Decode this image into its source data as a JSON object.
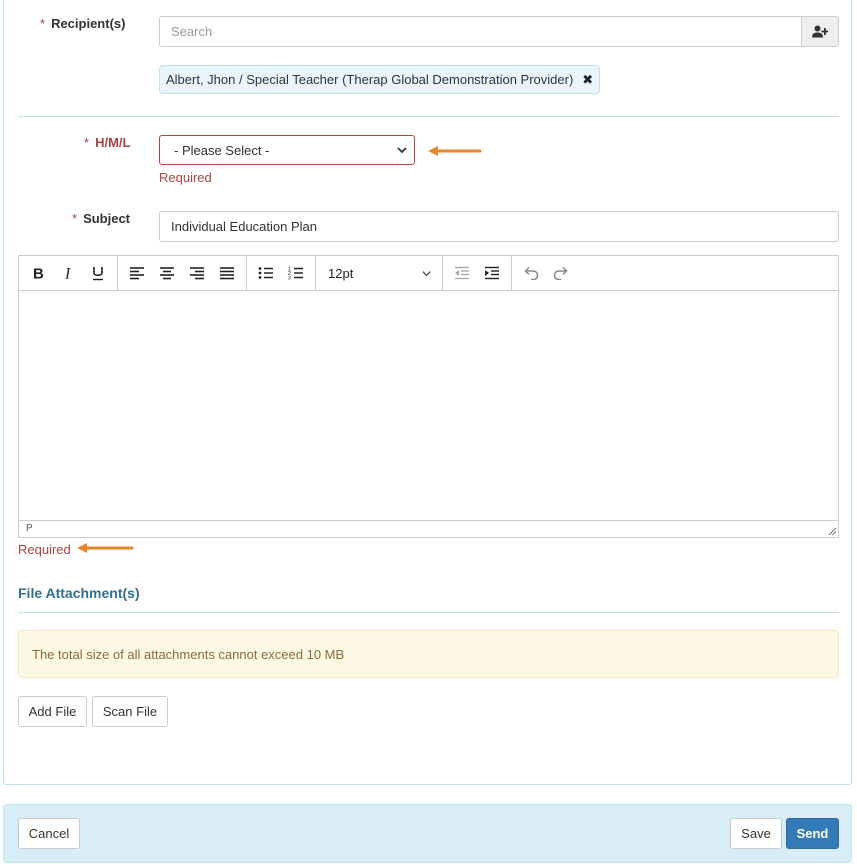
{
  "form": {
    "recipients": {
      "label": "Recipient(s)",
      "required_mark": "*",
      "placeholder": "Search",
      "add_icon": "user-plus-icon",
      "chips": [
        {
          "text": "Albert, Jhon / Special Teacher (Therap Global Demonstration Provider)",
          "remove_glyph": "✖"
        }
      ]
    },
    "hml": {
      "label": "H/M/L",
      "required_mark": "*",
      "selected": "- Please Select -",
      "error": "Required"
    },
    "subject": {
      "label": "Subject",
      "required_mark": "*",
      "value": "Individual Education Plan"
    },
    "editor": {
      "font_size": "12pt",
      "status_path": "P",
      "error": "Required",
      "toolbar_icons": [
        "bold-icon",
        "italic-icon",
        "underline-icon",
        "align-left-icon",
        "align-center-icon",
        "align-right-icon",
        "align-justify-icon",
        "bullet-list-icon",
        "numbered-list-icon",
        "outdent-icon",
        "indent-icon",
        "undo-icon",
        "redo-icon"
      ]
    },
    "attachments": {
      "title": "File Attachment(s)",
      "notice": "The total size of all attachments cannot exceed 10 MB",
      "add_file_label": "Add File",
      "scan_file_label": "Scan File"
    }
  },
  "footer": {
    "cancel_label": "Cancel",
    "save_label": "Save",
    "send_label": "Send"
  },
  "colors": {
    "error": "#a94442",
    "arrow": "#e8862a",
    "primary": "#337ab7",
    "footer_bg": "#d9edf7",
    "notice_bg": "#fcf8e3"
  }
}
